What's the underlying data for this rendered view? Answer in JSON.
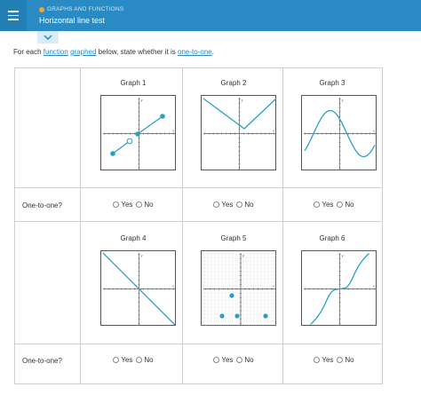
{
  "header": {
    "breadcrumb": "GRAPHS AND FUNCTIONS",
    "title": "Horizontal line test"
  },
  "instruction": {
    "prefix": "For each ",
    "link_function": "function",
    "link_graphed": "graphed",
    "middle": " below, state whether it is ",
    "link_one_to_one": "one-to-one",
    "suffix": "."
  },
  "rows": [
    {
      "label": "One-to-one?"
    },
    {
      "label": "One-to-one?"
    }
  ],
  "graphs": [
    {
      "title": "Graph 1",
      "yes": "Yes",
      "no": "No"
    },
    {
      "title": "Graph 2",
      "yes": "Yes",
      "no": "No"
    },
    {
      "title": "Graph 3",
      "yes": "Yes",
      "no": "No"
    },
    {
      "title": "Graph 4",
      "yes": "Yes",
      "no": "No"
    },
    {
      "title": "Graph 5",
      "yes": "Yes",
      "no": "No"
    },
    {
      "title": "Graph 6",
      "yes": "Yes",
      "no": "No"
    }
  ],
  "axis": {
    "x": "x",
    "y": "y"
  },
  "colors": {
    "accent": "#2a8bc4",
    "curve": "#2a9fc4",
    "header": "#2a8bc4"
  }
}
